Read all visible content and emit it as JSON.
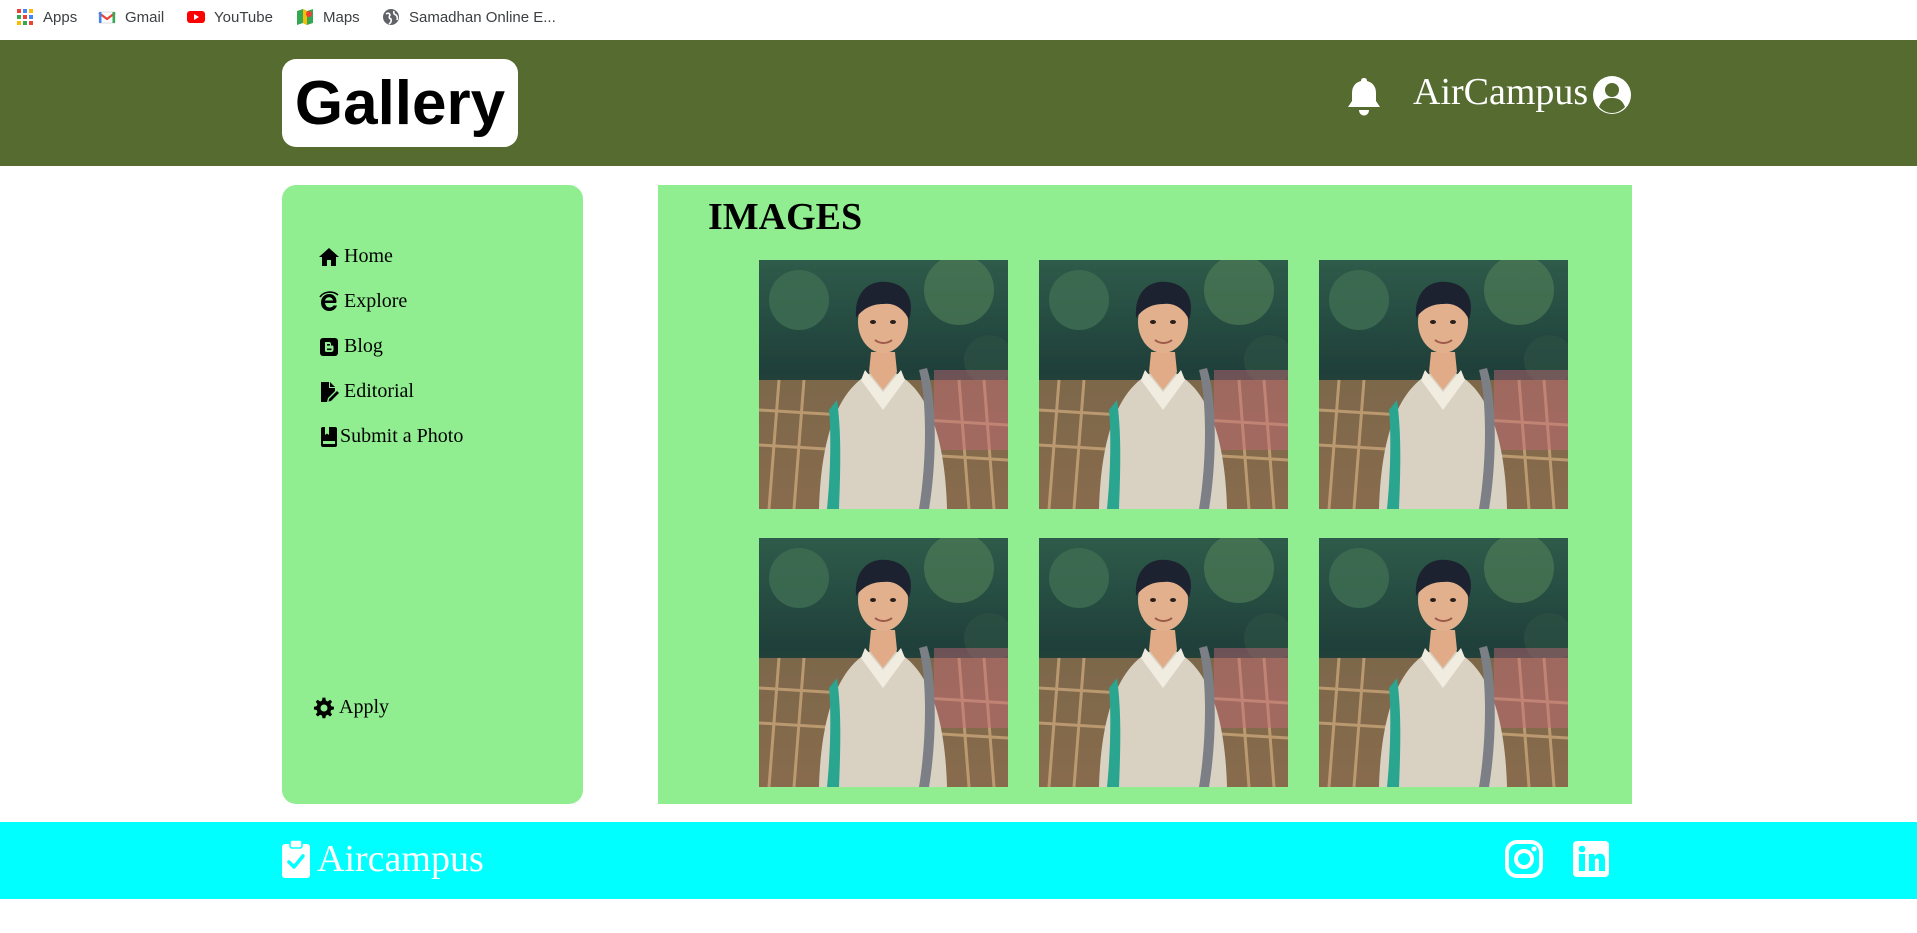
{
  "bookmarks": [
    {
      "label": "Apps",
      "icon": "apps-grid-icon"
    },
    {
      "label": "Gmail",
      "icon": "gmail-icon"
    },
    {
      "label": "YouTube",
      "icon": "youtube-icon"
    },
    {
      "label": "Maps",
      "icon": "maps-icon"
    },
    {
      "label": "Samadhan Online E...",
      "icon": "globe-icon"
    }
  ],
  "header": {
    "logo": "Gallery",
    "brand": "AirCampus",
    "icons": [
      "bell-icon",
      "user-circle-icon"
    ]
  },
  "sidebar": {
    "items": [
      {
        "label": "Home",
        "icon": "home-icon"
      },
      {
        "label": "Explore",
        "icon": "internet-explorer-icon"
      },
      {
        "label": "Blog",
        "icon": "blogger-icon"
      },
      {
        "label": "Editorial",
        "icon": "file-signature-icon"
      },
      {
        "label": "Submit a Photo",
        "icon": "book-icon"
      }
    ],
    "apply": {
      "label": "Apply",
      "icon": "gear-icon"
    }
  },
  "main": {
    "title": "IMAGES",
    "images": [
      {
        "alt": "portrait photo 1"
      },
      {
        "alt": "portrait photo 2"
      },
      {
        "alt": "portrait photo 3"
      },
      {
        "alt": "portrait photo 4"
      },
      {
        "alt": "portrait photo 5"
      },
      {
        "alt": "portrait photo 6"
      }
    ]
  },
  "footer": {
    "brand": "Aircampus",
    "icons": [
      "clipboard-check-icon",
      "instagram-icon",
      "linkedin-icon"
    ]
  },
  "colors": {
    "header_bg": "#556b2f",
    "panel_bg": "#90ee90",
    "footer_bg": "#00ffff"
  }
}
